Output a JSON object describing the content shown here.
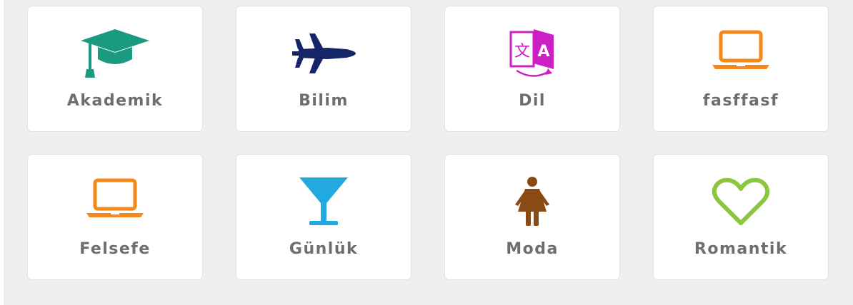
{
  "categories": [
    {
      "label": "Akademik",
      "icon": "graduation-cap-icon",
      "color": "#1a9a80"
    },
    {
      "label": "Bilim",
      "icon": "fighter-jet-icon",
      "color": "#16246a"
    },
    {
      "label": "Dil",
      "icon": "translate-icon",
      "color": "#cc1fc4"
    },
    {
      "label": "fasffasf",
      "icon": "laptop-icon",
      "color": "#f5881a"
    },
    {
      "label": "Felsefe",
      "icon": "laptop-icon",
      "color": "#f5881a"
    },
    {
      "label": "Günlük",
      "icon": "cocktail-glass-icon",
      "color": "#22a9df"
    },
    {
      "label": "Moda",
      "icon": "female-figure-icon",
      "color": "#8a4a14"
    },
    {
      "label": "Romantik",
      "icon": "heart-icon",
      "color": "#8cc63f"
    }
  ]
}
